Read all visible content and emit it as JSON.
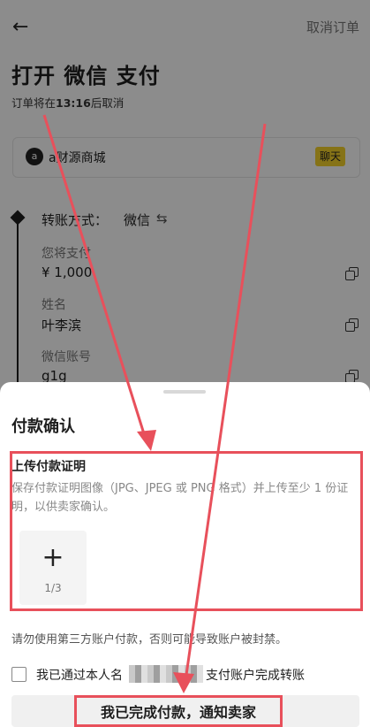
{
  "header": {
    "back_icon": "arrow-left-icon",
    "cancel_label": "取消订单"
  },
  "title": "打开 微信 支付",
  "timer": {
    "prefix": "订单将在",
    "time": "13:16",
    "suffix": "后取消"
  },
  "merchant": {
    "avatar_letter": "a",
    "name": "a财源商城",
    "chat_label": "聊天"
  },
  "transfer": {
    "method_label": "转账方式：",
    "method_value": "微信",
    "swap_icon": "swap-icon",
    "fields": [
      {
        "label": "您将支付",
        "value": "¥ 1,000"
      },
      {
        "label": "姓名",
        "value": "叶李滨"
      },
      {
        "label": "微信账号",
        "value": "g1g"
      }
    ]
  },
  "sheet": {
    "title": "付款确认",
    "upload_title": "上传付款证明",
    "upload_desc": "保存付款证明图像（JPG、JPEG 或 PNG 格式）并上传至少 1 份证明，以供卖家确认。",
    "upload_plus": "+",
    "upload_count": "1/3",
    "warning": "请勿使用第三方账户付款，否则可能导致账户被封禁。",
    "confirm_prefix": "我已通过本人名",
    "confirm_suffix": "支付账户完成转账",
    "submit_label": "我已完成付款，通知卖家"
  },
  "colors": {
    "accent_yellow": "#f5d12a",
    "annotation_red": "#e8505b"
  }
}
